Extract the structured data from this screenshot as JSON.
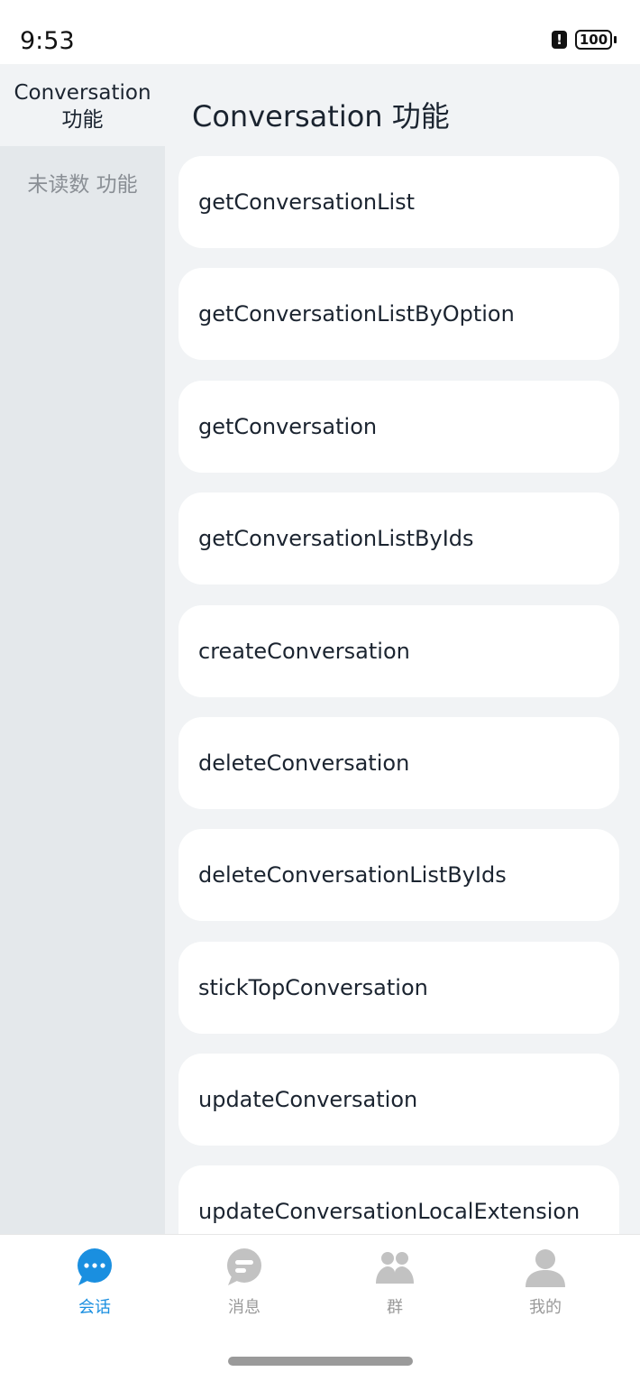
{
  "status_bar": {
    "time": "9:53",
    "battery": "100"
  },
  "sidebar": {
    "items": [
      {
        "label": "Conversation\n功能"
      },
      {
        "label": "未读数 功能"
      }
    ]
  },
  "main": {
    "title": "Conversation 功能",
    "items": [
      "getConversationList",
      "getConversationListByOption",
      "getConversation",
      "getConversationListByIds",
      "createConversation",
      "deleteConversation",
      "deleteConversationListByIds",
      "stickTopConversation",
      "updateConversation",
      "updateConversationLocalExtension"
    ]
  },
  "tabbar": {
    "tabs": [
      {
        "label": "会话",
        "icon": "chat-bubble-icon",
        "active": true
      },
      {
        "label": "消息",
        "icon": "message-icon",
        "active": false
      },
      {
        "label": "群",
        "icon": "group-icon",
        "active": false
      },
      {
        "label": "我的",
        "icon": "person-icon",
        "active": false
      }
    ],
    "accent": "#1a8fe0",
    "inactive": "#c2c2c2"
  }
}
